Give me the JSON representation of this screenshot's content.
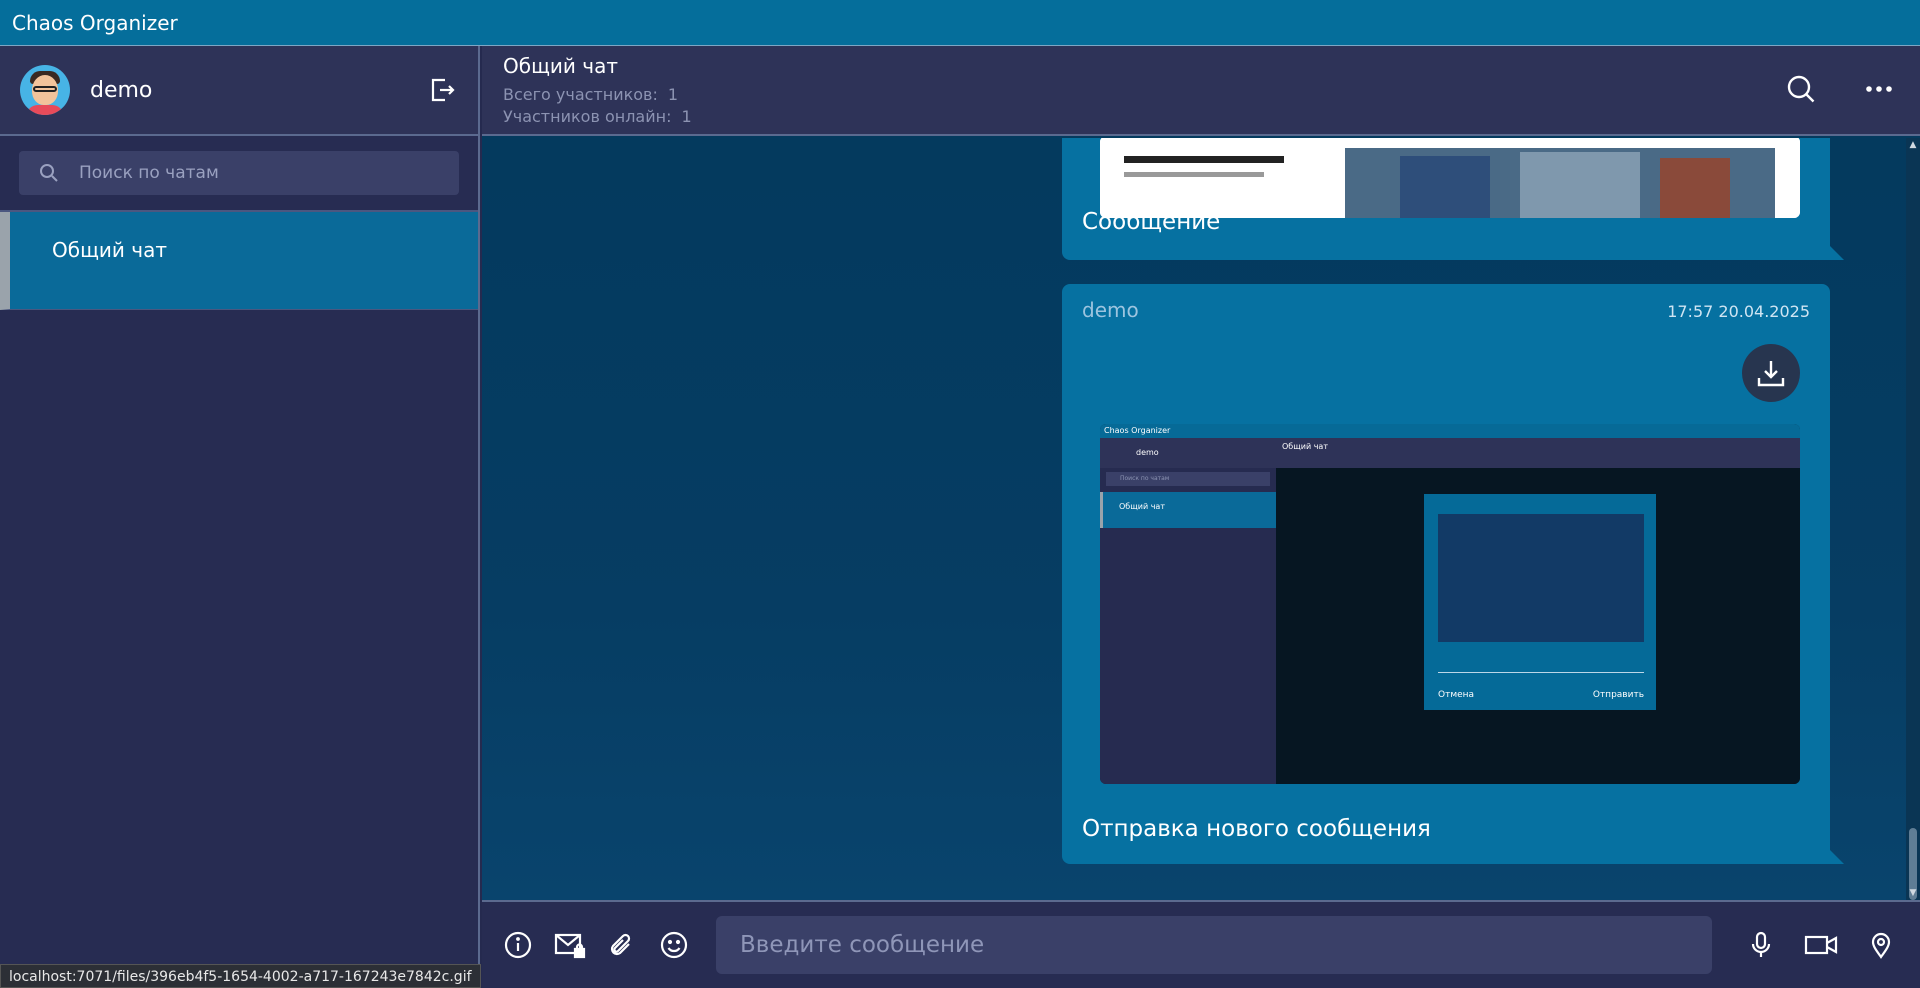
{
  "app": {
    "title": "Chaos Organizer"
  },
  "sidebar": {
    "username": "demo",
    "search_placeholder": "Поиск по чатам",
    "chats": [
      {
        "label": "Общий чат"
      }
    ]
  },
  "chat_header": {
    "title": "Общий чат",
    "total_label": "Всего участников:",
    "total_value": "1",
    "online_label": "Участников онлайн:",
    "online_value": "1"
  },
  "messages": [
    {
      "text": "Сообщение"
    },
    {
      "author": "demo",
      "time": "17:57 20.04.2025",
      "text": "Отправка нового сообщения",
      "preview": {
        "app_title": "Chaos Organizer",
        "username": "demo",
        "search_placeholder": "Поиск по чатам",
        "chat_label": "Общий чат",
        "chat_title": "Общий чат",
        "cancel": "Отмена",
        "send": "Отправить"
      }
    }
  ],
  "composer": {
    "placeholder": "Введите сообщение"
  },
  "status_url": "localhost:7071/files/396eb4f5-1654-4002-a717-167243e7842c.gif",
  "colors": {
    "accent": "#056e9b",
    "sidebar_bg": "#272c52",
    "message_bg": "#0671a1",
    "main_bg": "#03395d"
  }
}
